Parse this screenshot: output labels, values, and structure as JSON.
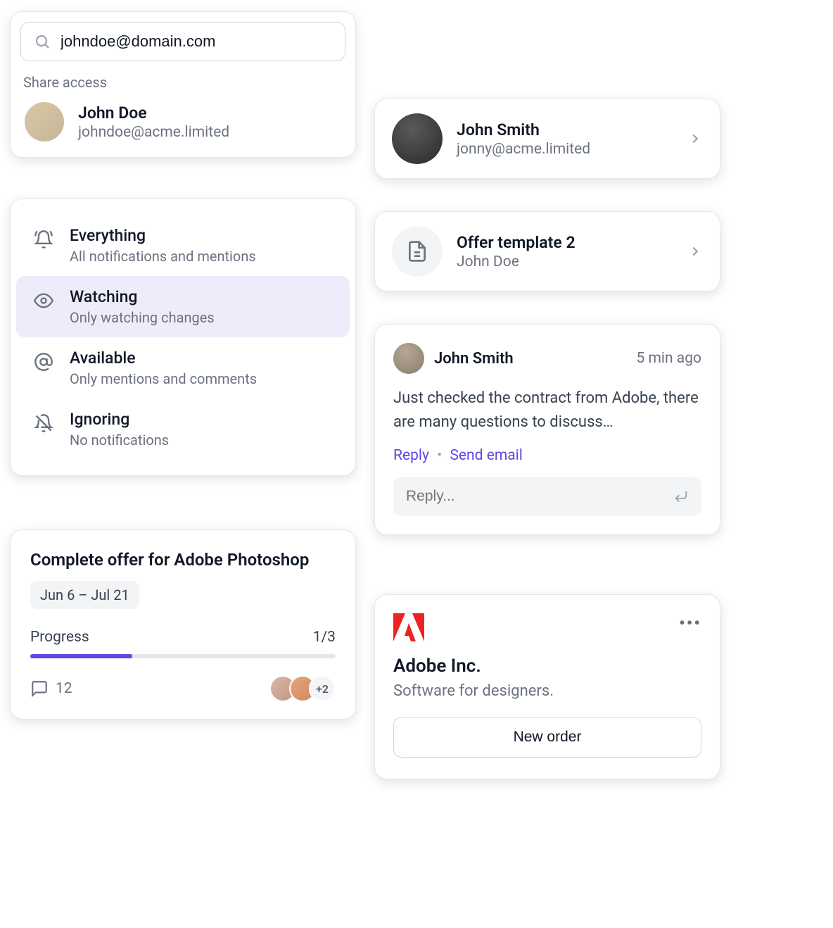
{
  "share": {
    "search_value": "johndoe@domain.com",
    "label": "Share access",
    "user": {
      "name": "John Doe",
      "email": "johndoe@acme.limited"
    }
  },
  "notif": {
    "options": [
      {
        "title": "Everything",
        "sub": "All notifications and mentions"
      },
      {
        "title": "Watching",
        "sub": "Only watching changes"
      },
      {
        "title": "Available",
        "sub": "Only mentions and comments"
      },
      {
        "title": "Ignoring",
        "sub": "No notifications"
      }
    ]
  },
  "task": {
    "title": "Complete offer for Adobe Photoshop",
    "date_range": "Jun 6 – Jul 21",
    "progress_label": "Progress",
    "progress_value": "1/3",
    "progress_fraction": 0.333,
    "comment_count": "12",
    "extra_avatars": "+2"
  },
  "jsmith": {
    "name": "John Smith",
    "email": "jonny@acme.limited"
  },
  "offer": {
    "title": "Offer template 2",
    "author": "John Doe"
  },
  "comment": {
    "author": "John Smith",
    "time": "5 min ago",
    "body": "Just checked the contract from Adobe, there are many questions to discuss…",
    "reply_label": "Reply",
    "send_email_label": "Send email",
    "reply_placeholder": "Reply..."
  },
  "adobe": {
    "company": "Adobe Inc.",
    "tagline": "Software for designers.",
    "button": "New order"
  }
}
